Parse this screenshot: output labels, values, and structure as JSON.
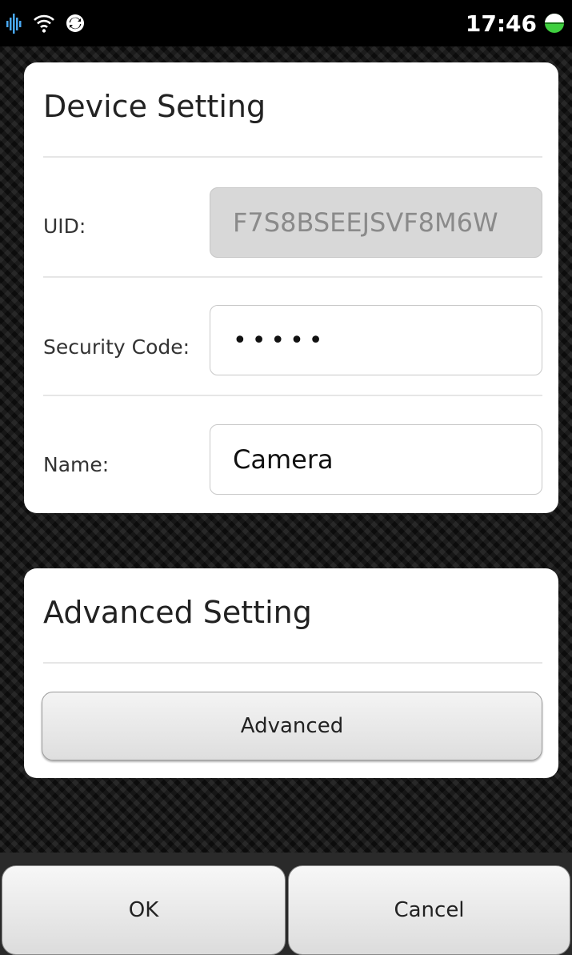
{
  "status_bar": {
    "time": "17:46",
    "icons": [
      "signal-bars-icon",
      "wifi-icon",
      "sync-icon",
      "battery-icon"
    ],
    "battery_color": "#3fcf3f"
  },
  "device_setting": {
    "title": "Device Setting",
    "uid_label": "UID:",
    "uid_value": "F7S8BSEEJSVF8M6W",
    "security_code_label": "Security Code:",
    "security_code_value": "•••••",
    "name_label": "Name:",
    "name_value": "Camera"
  },
  "advanced_setting": {
    "title": "Advanced Setting",
    "button_label": "Advanced"
  },
  "footer": {
    "ok_label": "OK",
    "cancel_label": "Cancel"
  }
}
